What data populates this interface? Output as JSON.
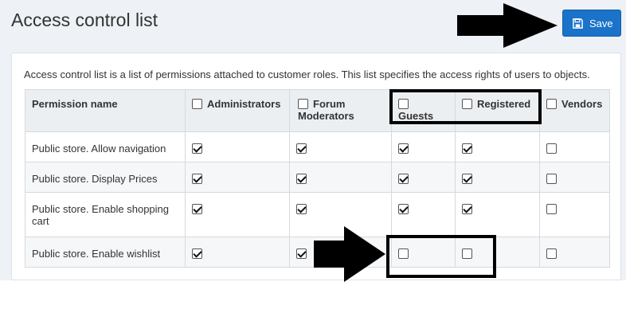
{
  "page": {
    "title": "Access control list",
    "save_label": "Save"
  },
  "description": "Access control list is a list of permissions attached to customer roles. This list specifies the access rights of users to objects.",
  "table": {
    "first_header": "Permission name",
    "roles": [
      {
        "name": "Administrators"
      },
      {
        "name": "Forum Moderators"
      },
      {
        "name": "Guests"
      },
      {
        "name": "Registered"
      },
      {
        "name": "Vendors"
      }
    ],
    "rows": [
      {
        "permission": "Public store. Allow navigation",
        "checks": [
          true,
          true,
          true,
          true,
          false
        ]
      },
      {
        "permission": "Public store. Display Prices",
        "checks": [
          true,
          true,
          true,
          true,
          false
        ]
      },
      {
        "permission": "Public store. Enable shopping cart",
        "checks": [
          true,
          true,
          true,
          true,
          false
        ]
      },
      {
        "permission": "Public store. Enable wishlist",
        "checks": [
          true,
          true,
          false,
          false,
          false
        ]
      }
    ]
  },
  "icons": {
    "save": "floppy-disk-icon",
    "annotation_arrow": "black-arrow-right"
  }
}
